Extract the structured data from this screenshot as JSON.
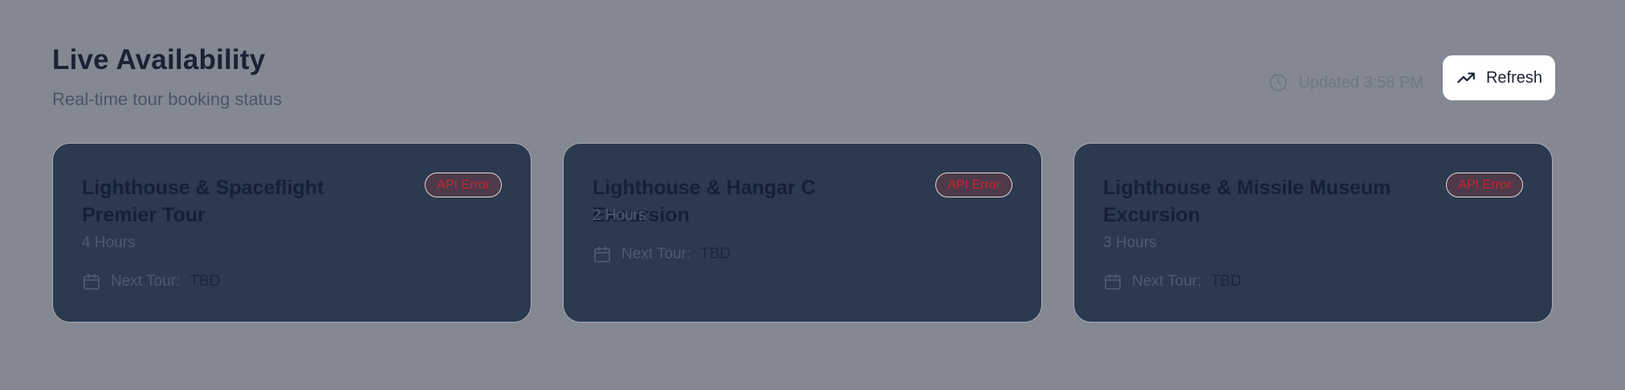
{
  "header": {
    "title": "Live Availability",
    "subtitle": "Real-time tour booking status",
    "updated": "Updated 3:58 PM",
    "refresh_label": "Refresh"
  },
  "cards": [
    {
      "title": "Lighthouse & Spaceflight Premier Tour",
      "badge": "API Error",
      "duration": "4 Hours",
      "next_tour_label": "Next Tour:",
      "next_tour_value": "TBD"
    },
    {
      "title": "Lighthouse & Hangar C Excursion",
      "badge": "API Error",
      "duration": "2 Hours",
      "next_tour_label": "Next Tour:",
      "next_tour_value": "TBD"
    },
    {
      "title": "Lighthouse & Missile Museum Excursion",
      "badge": "API Error",
      "duration": "3 Hours",
      "next_tour_label": "Next Tour:",
      "next_tour_value": "TBD"
    }
  ],
  "colors": {
    "background": "#848892",
    "card_background": "#2b3a4f",
    "error_badge_text": "#cf2330",
    "refresh_button_background": "#ffffff"
  },
  "icons": {
    "clock": "clock-icon",
    "refresh": "trending-up-icon",
    "calendar": "calendar-icon"
  }
}
